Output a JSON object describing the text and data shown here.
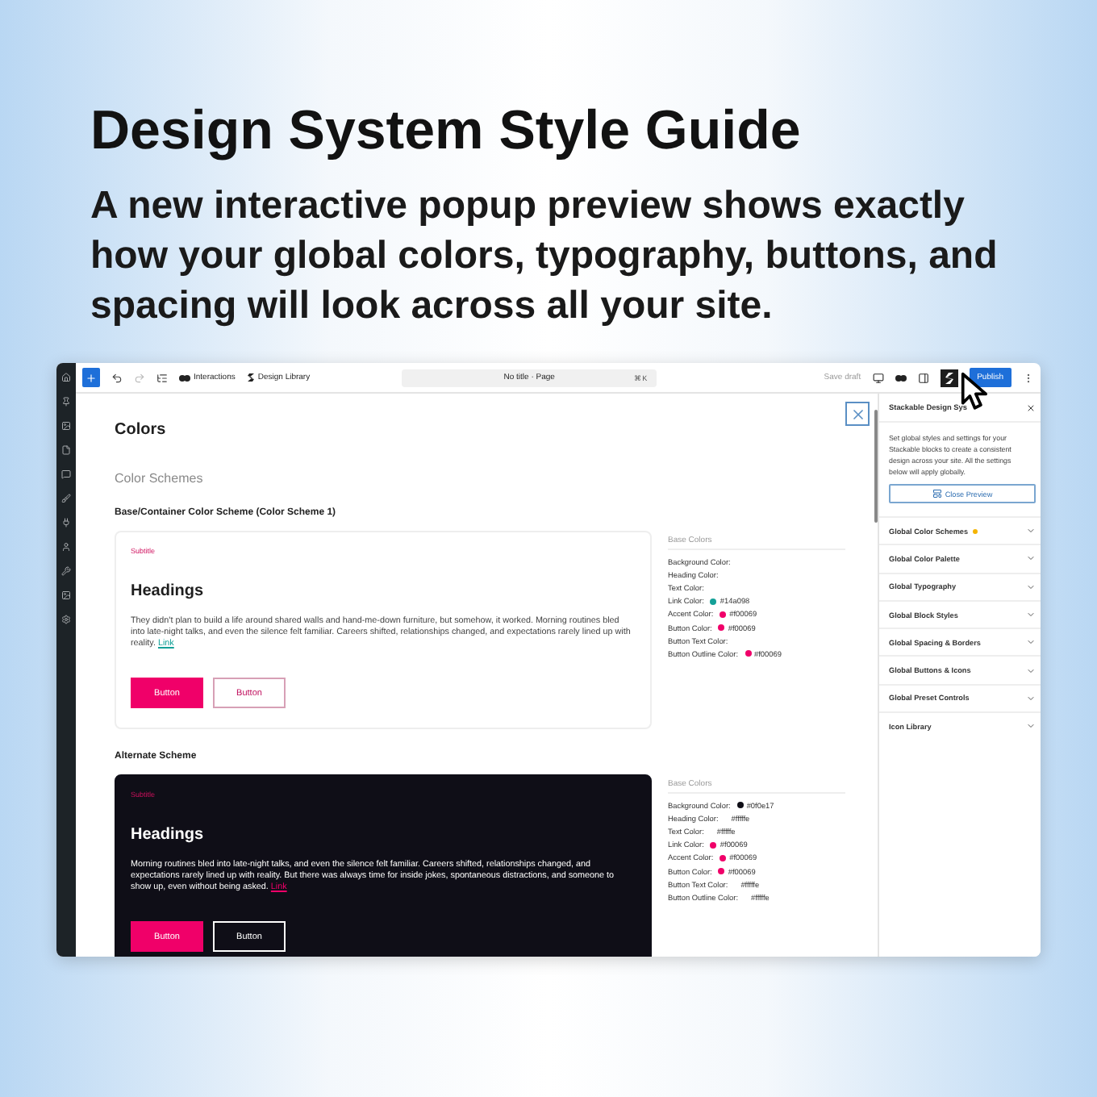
{
  "headline": "Design System Style Guide",
  "subheadline": "A new interactive popup preview shows exactly how your global colors, typography, buttons, and spacing will look across all your site.",
  "toolbar": {
    "interactions": "Interactions",
    "library": "Design Library",
    "document": "No title · Page",
    "shortcut": "⌘K",
    "save": "Save draft",
    "publish": "Publish"
  },
  "preview": {
    "title": "Colors",
    "section": "Color Schemes",
    "schemes": [
      {
        "title": "Base/Container Color Scheme (Color Scheme 1)",
        "dark": false,
        "subtitle": "Subtitle",
        "heading": "Headings",
        "body": "They didn't plan to build a life around shared walls and hand-me-down furniture, but somehow, it worked. Morning routines bled into late-night talks, and even the silence felt familiar. Careers shifted, relationships changed, and expectations rarely lined up with reality.",
        "link": "Link",
        "buttons": [
          "Button",
          "Button"
        ],
        "colors_title": "Base Colors",
        "colors": [
          {
            "label": "Background Color:"
          },
          {
            "label": "Heading Color:"
          },
          {
            "label": "Text Color:"
          },
          {
            "label": "Link Color:",
            "value": "#14a098",
            "color": "#14a098"
          },
          {
            "label": "Accent Color:",
            "value": "#f00069",
            "color": "#f00069"
          },
          {
            "label": "Button Color:",
            "value": "#f00069",
            "color": "#f00069"
          },
          {
            "label": "Button Text Color:"
          },
          {
            "label": "Button Outline Color:",
            "value": "#f00069",
            "color": "#f00069"
          }
        ]
      },
      {
        "title": "Alternate Scheme",
        "dark": true,
        "subtitle": "Subtitle",
        "heading": "Headings",
        "body": "Morning routines bled into late-night talks, and even the silence felt familiar. Careers shifted, relationships changed, and expectations rarely lined up with reality. But there was always time for inside jokes, spontaneous distractions, and someone to show up, even without being asked.",
        "link": "Link",
        "buttons": [
          "Button",
          "Button"
        ],
        "colors_title": "Base Colors",
        "colors": [
          {
            "label": "Background Color:",
            "value": "#0f0e17",
            "color": "#0f0e17"
          },
          {
            "label": "Heading Color:",
            "value": "#fffffe"
          },
          {
            "label": "Text Color:",
            "value": "#fffffe"
          },
          {
            "label": "Link Color:",
            "value": "#f00069",
            "color": "#f00069"
          },
          {
            "label": "Accent Color:",
            "value": "#f00069",
            "color": "#f00069"
          },
          {
            "label": "Button Color:",
            "value": "#f00069",
            "color": "#f00069"
          },
          {
            "label": "Button Text Color:",
            "value": "#fffffe"
          },
          {
            "label": "Button Outline Color:",
            "value": "#fffffe"
          }
        ]
      }
    ]
  },
  "sidebar": {
    "title": "Stackable Design Sys",
    "description": "Set global styles and settings for your Stackable blocks to create a consistent design across your site. All the settings below will apply globally.",
    "close_preview": "Close Preview",
    "panels": [
      {
        "label": "Global Color Schemes",
        "modified": true
      },
      {
        "label": "Global Color Palette",
        "modified": false
      },
      {
        "label": "Global Typography",
        "modified": false
      },
      {
        "label": "Global Block Styles",
        "modified": false
      },
      {
        "label": "Global Spacing & Borders",
        "modified": false
      },
      {
        "label": "Global Buttons & Icons",
        "modified": false
      },
      {
        "label": "Global Preset Controls",
        "modified": false
      },
      {
        "label": "Icon Library",
        "modified": false
      }
    ]
  }
}
